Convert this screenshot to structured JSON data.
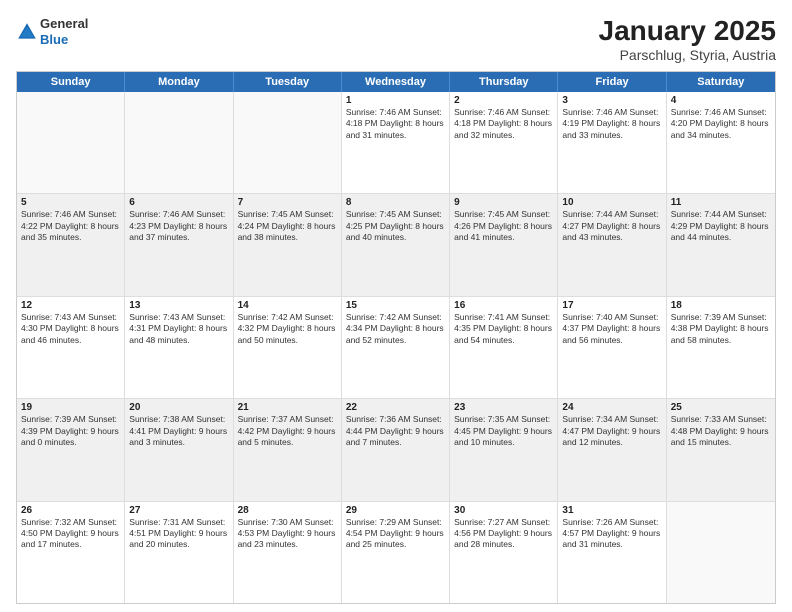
{
  "header": {
    "logo_general": "General",
    "logo_blue": "Blue",
    "title": "January 2025",
    "subtitle": "Parschlug, Styria, Austria"
  },
  "days": [
    "Sunday",
    "Monday",
    "Tuesday",
    "Wednesday",
    "Thursday",
    "Friday",
    "Saturday"
  ],
  "rows": [
    [
      {
        "day": "",
        "text": ""
      },
      {
        "day": "",
        "text": ""
      },
      {
        "day": "",
        "text": ""
      },
      {
        "day": "1",
        "text": "Sunrise: 7:46 AM\nSunset: 4:18 PM\nDaylight: 8 hours and 31 minutes."
      },
      {
        "day": "2",
        "text": "Sunrise: 7:46 AM\nSunset: 4:18 PM\nDaylight: 8 hours and 32 minutes."
      },
      {
        "day": "3",
        "text": "Sunrise: 7:46 AM\nSunset: 4:19 PM\nDaylight: 8 hours and 33 minutes."
      },
      {
        "day": "4",
        "text": "Sunrise: 7:46 AM\nSunset: 4:20 PM\nDaylight: 8 hours and 34 minutes."
      }
    ],
    [
      {
        "day": "5",
        "text": "Sunrise: 7:46 AM\nSunset: 4:22 PM\nDaylight: 8 hours and 35 minutes."
      },
      {
        "day": "6",
        "text": "Sunrise: 7:46 AM\nSunset: 4:23 PM\nDaylight: 8 hours and 37 minutes."
      },
      {
        "day": "7",
        "text": "Sunrise: 7:45 AM\nSunset: 4:24 PM\nDaylight: 8 hours and 38 minutes."
      },
      {
        "day": "8",
        "text": "Sunrise: 7:45 AM\nSunset: 4:25 PM\nDaylight: 8 hours and 40 minutes."
      },
      {
        "day": "9",
        "text": "Sunrise: 7:45 AM\nSunset: 4:26 PM\nDaylight: 8 hours and 41 minutes."
      },
      {
        "day": "10",
        "text": "Sunrise: 7:44 AM\nSunset: 4:27 PM\nDaylight: 8 hours and 43 minutes."
      },
      {
        "day": "11",
        "text": "Sunrise: 7:44 AM\nSunset: 4:29 PM\nDaylight: 8 hours and 44 minutes."
      }
    ],
    [
      {
        "day": "12",
        "text": "Sunrise: 7:43 AM\nSunset: 4:30 PM\nDaylight: 8 hours and 46 minutes."
      },
      {
        "day": "13",
        "text": "Sunrise: 7:43 AM\nSunset: 4:31 PM\nDaylight: 8 hours and 48 minutes."
      },
      {
        "day": "14",
        "text": "Sunrise: 7:42 AM\nSunset: 4:32 PM\nDaylight: 8 hours and 50 minutes."
      },
      {
        "day": "15",
        "text": "Sunrise: 7:42 AM\nSunset: 4:34 PM\nDaylight: 8 hours and 52 minutes."
      },
      {
        "day": "16",
        "text": "Sunrise: 7:41 AM\nSunset: 4:35 PM\nDaylight: 8 hours and 54 minutes."
      },
      {
        "day": "17",
        "text": "Sunrise: 7:40 AM\nSunset: 4:37 PM\nDaylight: 8 hours and 56 minutes."
      },
      {
        "day": "18",
        "text": "Sunrise: 7:39 AM\nSunset: 4:38 PM\nDaylight: 8 hours and 58 minutes."
      }
    ],
    [
      {
        "day": "19",
        "text": "Sunrise: 7:39 AM\nSunset: 4:39 PM\nDaylight: 9 hours and 0 minutes."
      },
      {
        "day": "20",
        "text": "Sunrise: 7:38 AM\nSunset: 4:41 PM\nDaylight: 9 hours and 3 minutes."
      },
      {
        "day": "21",
        "text": "Sunrise: 7:37 AM\nSunset: 4:42 PM\nDaylight: 9 hours and 5 minutes."
      },
      {
        "day": "22",
        "text": "Sunrise: 7:36 AM\nSunset: 4:44 PM\nDaylight: 9 hours and 7 minutes."
      },
      {
        "day": "23",
        "text": "Sunrise: 7:35 AM\nSunset: 4:45 PM\nDaylight: 9 hours and 10 minutes."
      },
      {
        "day": "24",
        "text": "Sunrise: 7:34 AM\nSunset: 4:47 PM\nDaylight: 9 hours and 12 minutes."
      },
      {
        "day": "25",
        "text": "Sunrise: 7:33 AM\nSunset: 4:48 PM\nDaylight: 9 hours and 15 minutes."
      }
    ],
    [
      {
        "day": "26",
        "text": "Sunrise: 7:32 AM\nSunset: 4:50 PM\nDaylight: 9 hours and 17 minutes."
      },
      {
        "day": "27",
        "text": "Sunrise: 7:31 AM\nSunset: 4:51 PM\nDaylight: 9 hours and 20 minutes."
      },
      {
        "day": "28",
        "text": "Sunrise: 7:30 AM\nSunset: 4:53 PM\nDaylight: 9 hours and 23 minutes."
      },
      {
        "day": "29",
        "text": "Sunrise: 7:29 AM\nSunset: 4:54 PM\nDaylight: 9 hours and 25 minutes."
      },
      {
        "day": "30",
        "text": "Sunrise: 7:27 AM\nSunset: 4:56 PM\nDaylight: 9 hours and 28 minutes."
      },
      {
        "day": "31",
        "text": "Sunrise: 7:26 AM\nSunset: 4:57 PM\nDaylight: 9 hours and 31 minutes."
      },
      {
        "day": "",
        "text": ""
      }
    ]
  ]
}
